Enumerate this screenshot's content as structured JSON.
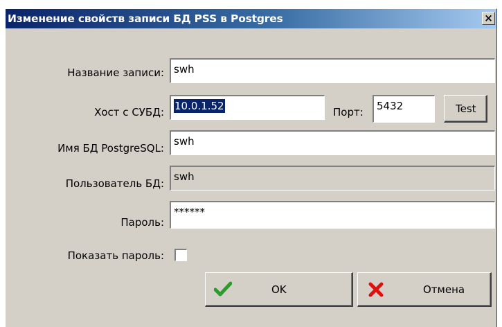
{
  "window": {
    "title": "Изменение свойств записи БД PSS в Postgres",
    "close_glyph": "×"
  },
  "form": {
    "record_name": {
      "label": "Название записи:",
      "value": "swh"
    },
    "host": {
      "label": "Хост с СУБД:",
      "value": "10.0.1.52"
    },
    "port": {
      "label": "Порт:",
      "value": "5432"
    },
    "test_button": "Test",
    "db_name": {
      "label": "Имя БД PostgreSQL:",
      "value": "swh"
    },
    "db_user": {
      "label": "Пользователь БД:",
      "value": "swh"
    },
    "password": {
      "label": "Пароль:",
      "value": "******"
    },
    "show_password": {
      "label": "Показать пароль:",
      "checked": false
    }
  },
  "buttons": {
    "ok": {
      "label": "OK",
      "icon": "checkmark-icon",
      "color": "#2e9a2e"
    },
    "cancel": {
      "label": "Отмена",
      "icon": "cross-icon",
      "color": "#e01010"
    }
  },
  "colors": {
    "titlebar_start": "#0a246a",
    "titlebar_end": "#a6caf0",
    "dialog_bg": "#d4d0c8",
    "selection": "#0a246a"
  }
}
